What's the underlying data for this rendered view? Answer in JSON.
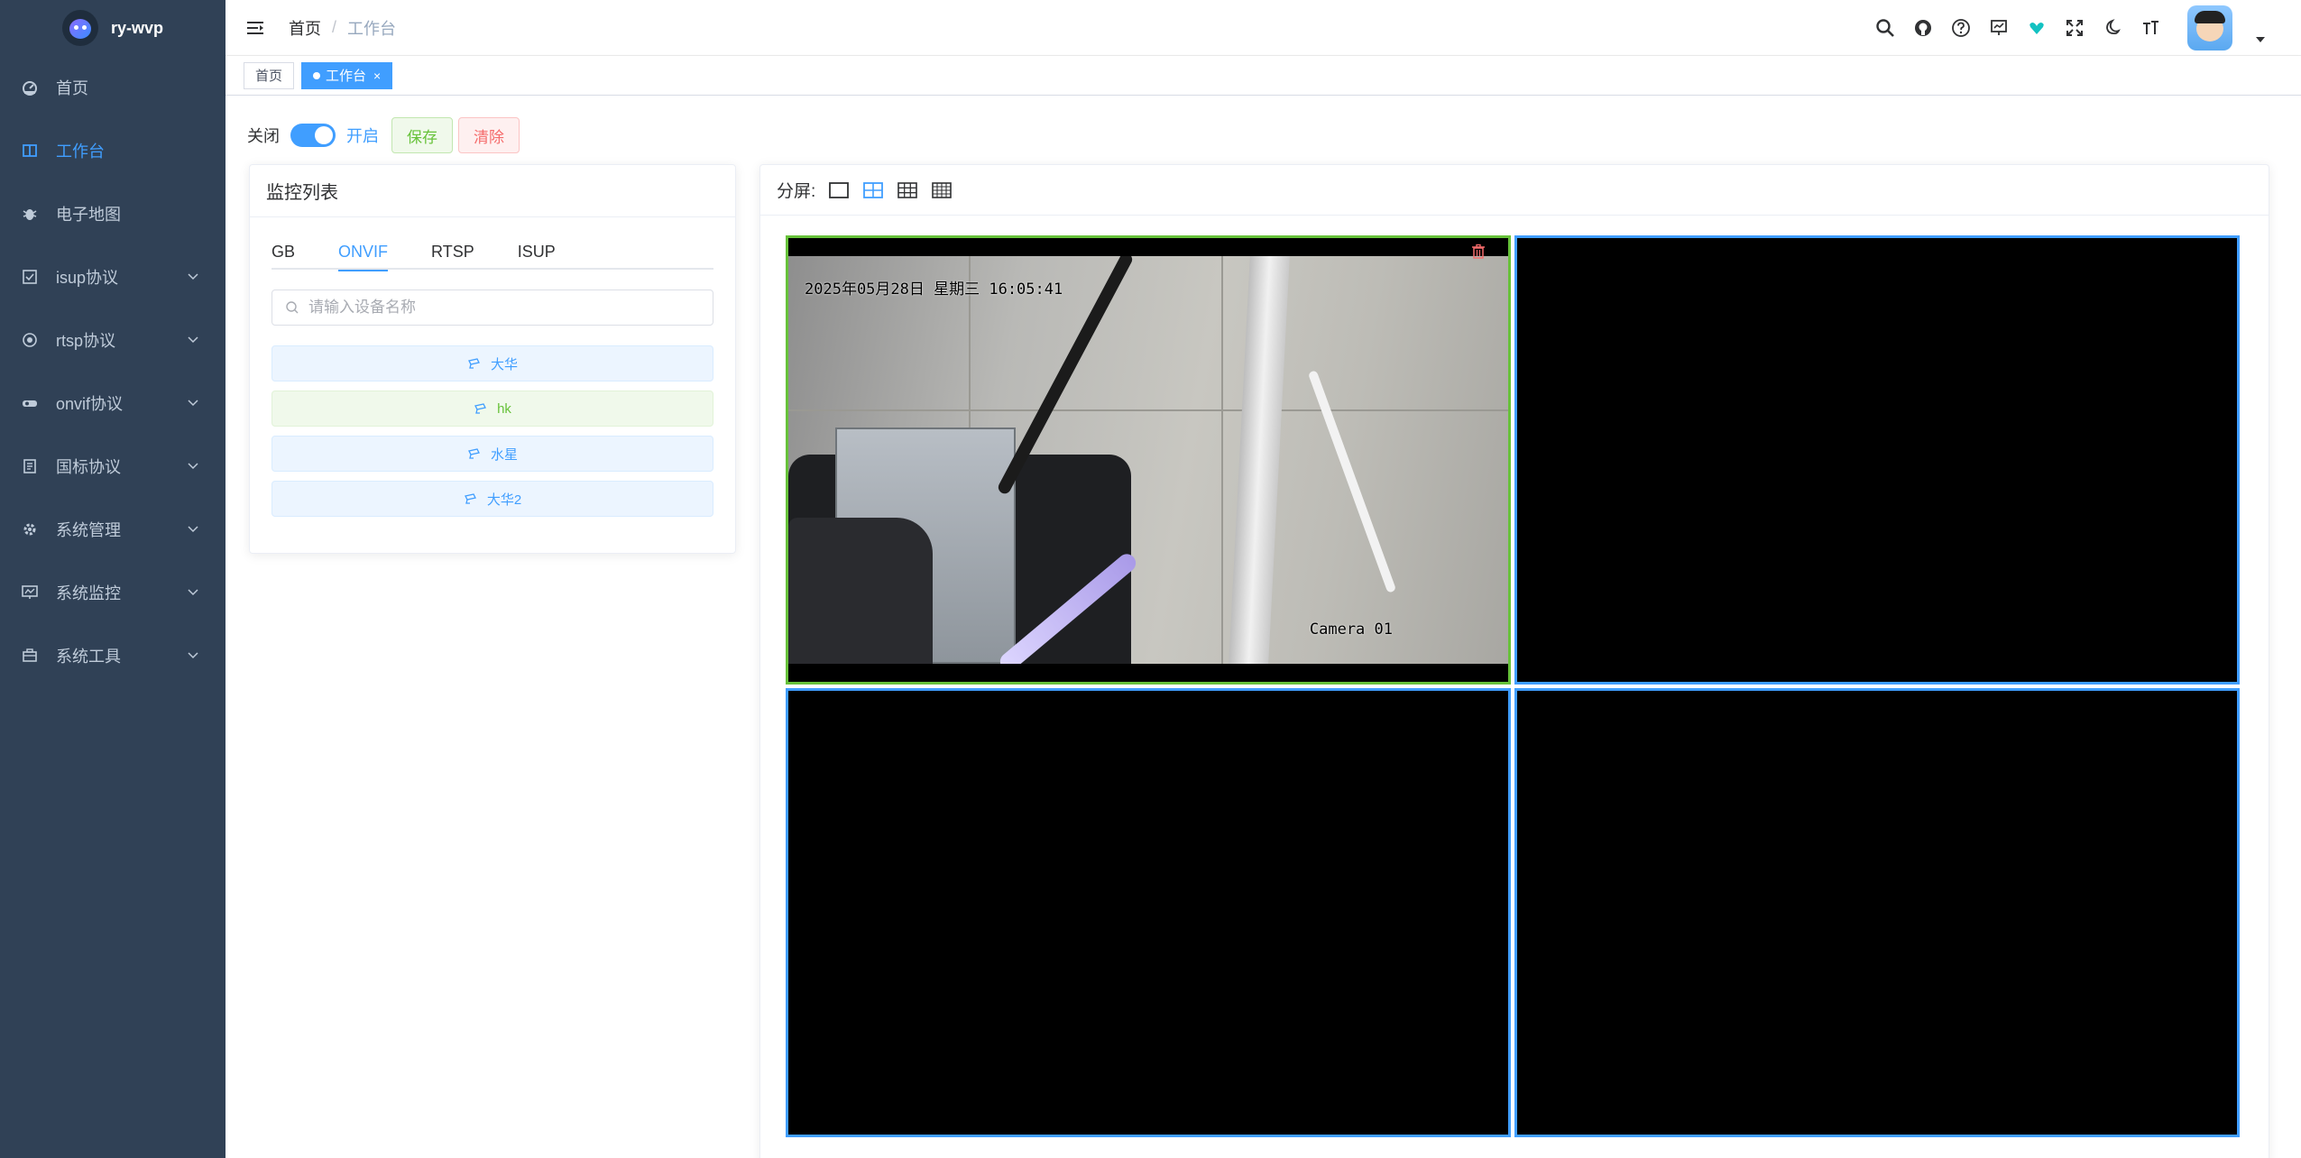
{
  "app": {
    "title": "ry-wvp"
  },
  "sidebar": {
    "items": [
      {
        "label": "首页",
        "icon": "dashboard-icon"
      },
      {
        "label": "工作台",
        "icon": "workbench-icon"
      },
      {
        "label": "电子地图",
        "icon": "bug-icon"
      },
      {
        "label": "isup协议",
        "icon": "checkbox-icon"
      },
      {
        "label": "rtsp协议",
        "icon": "link-icon"
      },
      {
        "label": "onvif协议",
        "icon": "camera-icon"
      },
      {
        "label": "国标协议",
        "icon": "document-icon"
      },
      {
        "label": "系统管理",
        "icon": "gear-icon"
      },
      {
        "label": "系统监控",
        "icon": "monitor-icon"
      },
      {
        "label": "系统工具",
        "icon": "toolbox-icon"
      }
    ]
  },
  "navbar": {
    "breadcrumb": {
      "home": "首页",
      "separator": "/",
      "current": "工作台"
    },
    "icons": [
      "search-icon",
      "github-icon",
      "question-icon",
      "screen-icon",
      "heart-icon",
      "fullscreen-icon",
      "moon-icon",
      "font-size-icon"
    ]
  },
  "tags": {
    "home": "首页",
    "active": "工作台",
    "close": "×"
  },
  "toolbar": {
    "off_label": "关闭",
    "on_label": "开启",
    "save": "保存",
    "clear": "清除"
  },
  "monitor": {
    "title": "监控列表",
    "tabs": [
      "GB",
      "ONVIF",
      "RTSP",
      "ISUP"
    ],
    "active_tab": "ONVIF",
    "search_placeholder": "请输入设备名称",
    "devices": [
      {
        "name": "大华",
        "style": "blue"
      },
      {
        "name": "hk",
        "style": "green"
      },
      {
        "name": "水星",
        "style": "blue"
      },
      {
        "name": "大华2",
        "style": "blue"
      }
    ]
  },
  "player": {
    "split_label": "分屏:",
    "timestamp": "2025年05月28日 星期三 16:05:41",
    "camera_label": "Camera 01"
  },
  "colors": {
    "sidebar_bg": "#304156",
    "accent": "#409eff",
    "success": "#67c23a",
    "danger": "#f56c6c"
  }
}
